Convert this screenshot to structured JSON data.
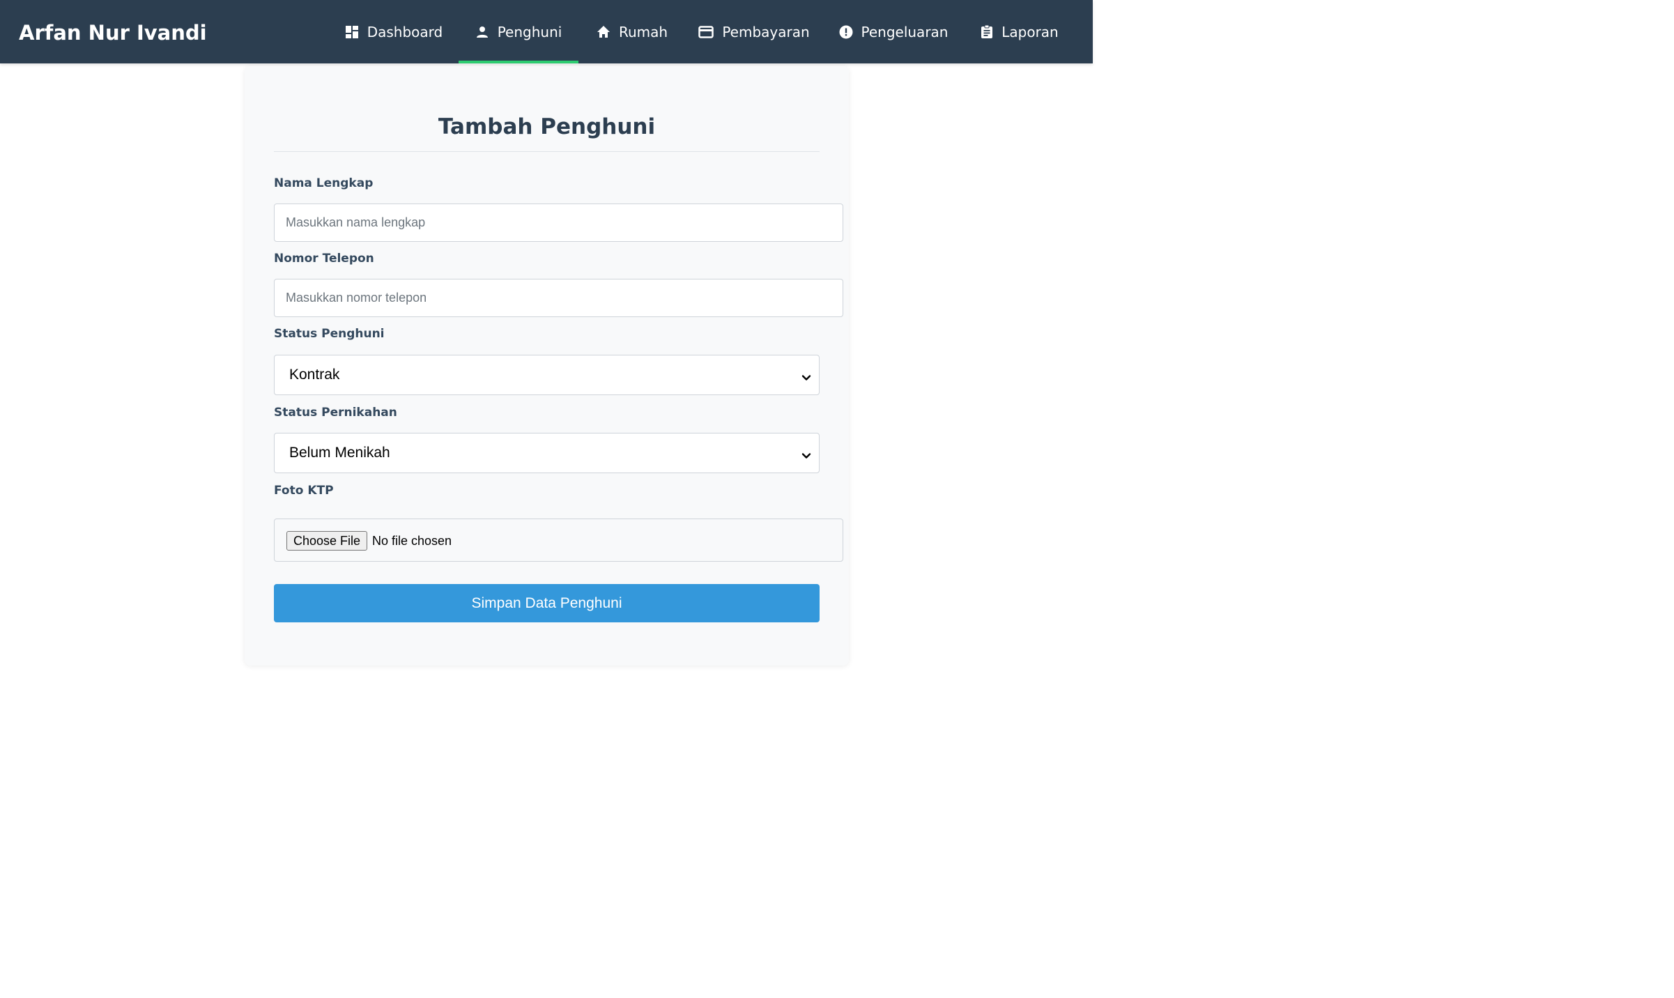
{
  "navbar": {
    "brand": "Arfan Nur Ivandi",
    "links": [
      {
        "label": "Dashboard",
        "icon": "dashboard-icon",
        "active": false
      },
      {
        "label": "Penghuni",
        "icon": "person-icon",
        "active": true
      },
      {
        "label": "Rumah",
        "icon": "home-icon",
        "active": false
      },
      {
        "label": "Pembayaran",
        "icon": "credit-card-icon",
        "active": false
      },
      {
        "label": "Pengeluaran",
        "icon": "alert-circle-icon",
        "active": false
      },
      {
        "label": "Laporan",
        "icon": "clipboard-icon",
        "active": false
      }
    ]
  },
  "form": {
    "title": "Tambah Penghuni",
    "nama": {
      "label": "Nama Lengkap",
      "placeholder": "Masukkan nama lengkap",
      "value": ""
    },
    "telepon": {
      "label": "Nomor Telepon",
      "placeholder": "Masukkan nomor telepon",
      "value": ""
    },
    "status_penghuni": {
      "label": "Status Penghuni",
      "selected": "Kontrak"
    },
    "status_pernikahan": {
      "label": "Status Pernikahan",
      "selected": "Belum Menikah"
    },
    "foto_ktp": {
      "label": "Foto KTP",
      "button": "Choose File",
      "status": "No file chosen"
    },
    "submit_label": "Simpan Data Penghuni"
  },
  "colors": {
    "navbar": "#2c3e50",
    "active_indicator": "#2ecc71",
    "primary_button": "#3498db",
    "title": "#2c3e50"
  }
}
